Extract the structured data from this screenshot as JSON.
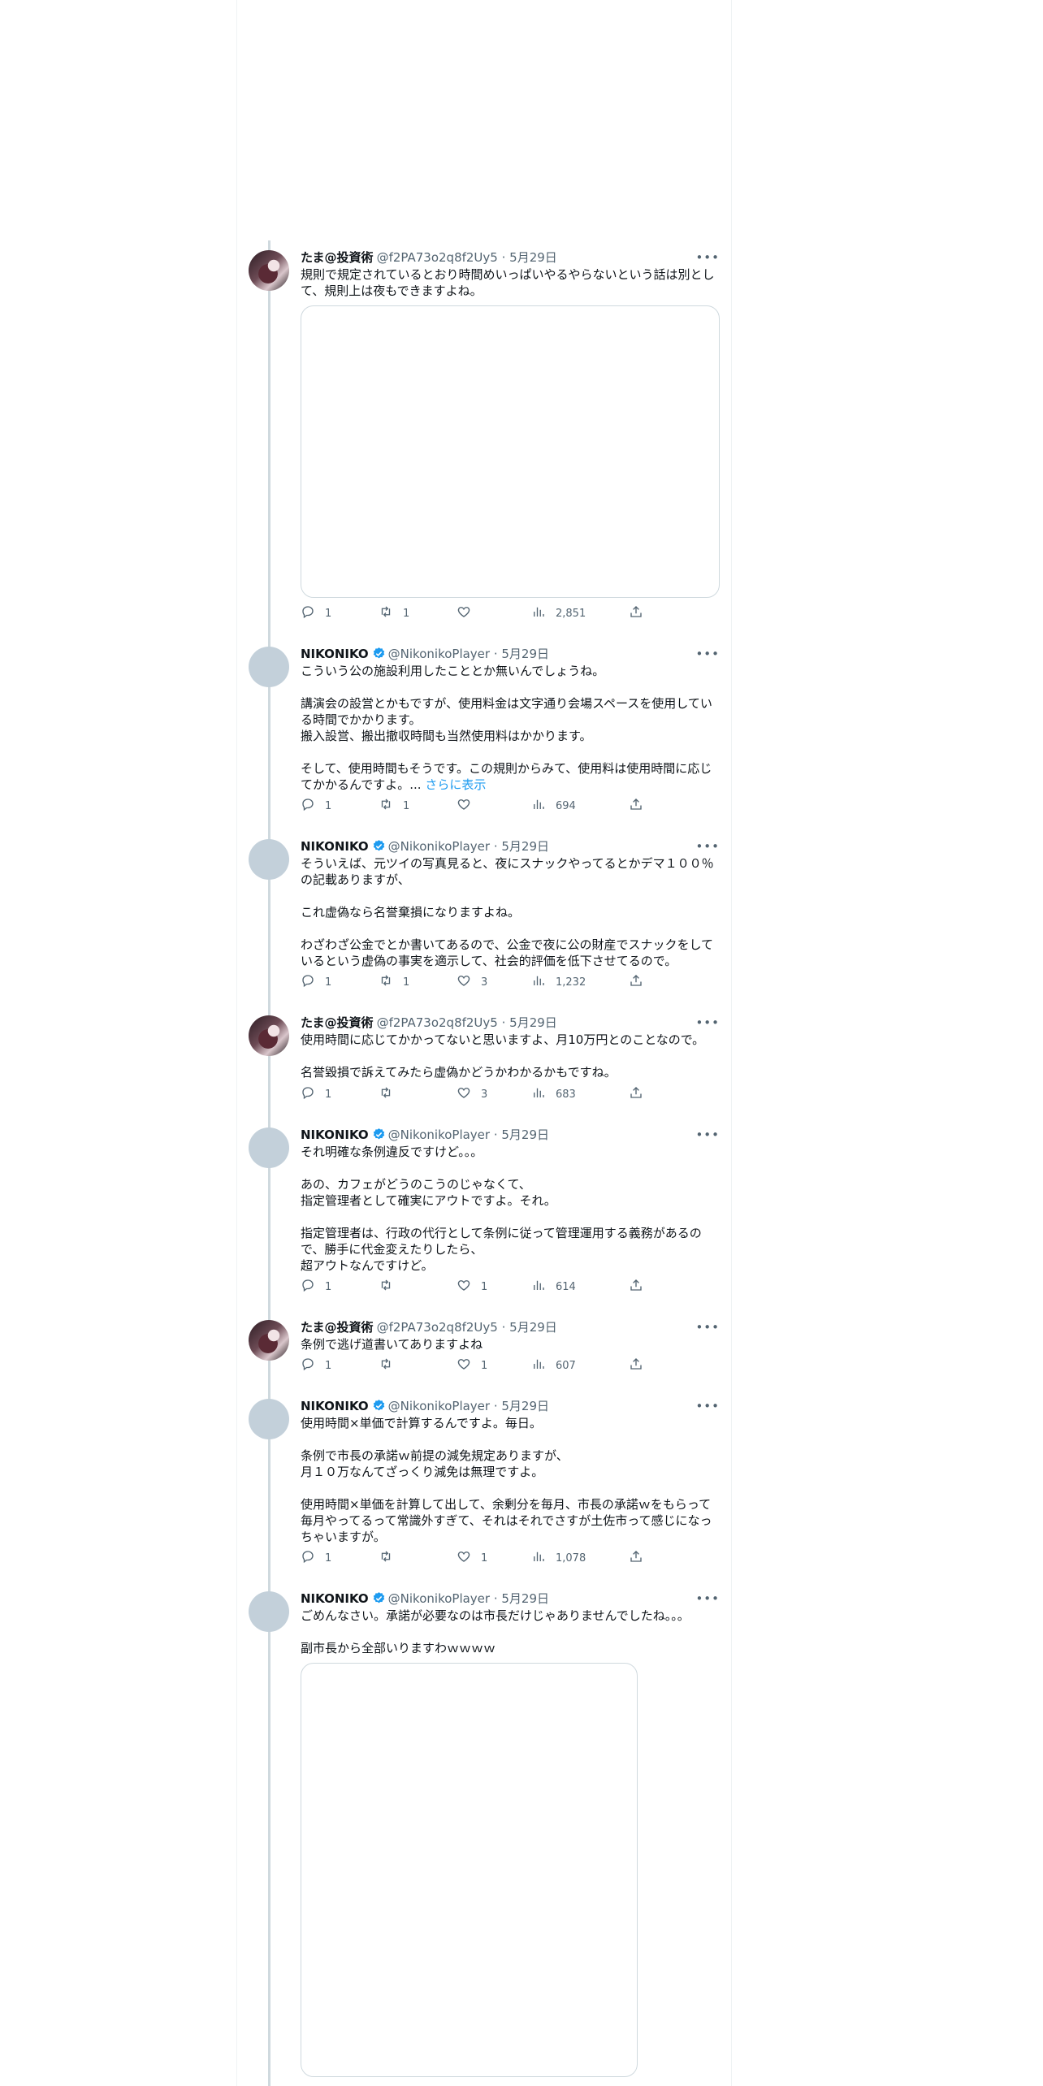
{
  "tweets": [
    {
      "name": "たま@投資術",
      "verified": false,
      "handle": "@f2PA73o2q8f2Uy5",
      "time": "5月29日",
      "text": "規則で規定されているとおり時間めいっぱいやるやらないという話は別として、規則上は夜もできますよね。",
      "show_more": "",
      "has_media": true,
      "replies": "1",
      "retweets": "1",
      "likes": "",
      "views": "2,851"
    },
    {
      "name": "NIKONIKO",
      "verified": true,
      "handle": "@NikonikoPlayer",
      "time": "5月29日",
      "text": "こういう公の施設利用したこととか無いんでしょうね。\n\n講演会の設営とかもですが、使用料金は文字通り会場スペースを使用している時間でかかります。\n搬入設営、搬出撤収時間も当然使用料はかかります。\n\nそして、使用時間もそうです。この規則からみて、使用料は使用時間に応じてかかるんですよ。... ",
      "show_more": "さらに表示",
      "has_media": false,
      "replies": "1",
      "retweets": "1",
      "likes": "",
      "views": "694"
    },
    {
      "name": "NIKONIKO",
      "verified": true,
      "handle": "@NikonikoPlayer",
      "time": "5月29日",
      "text": "そういえば、元ツイの写真見ると、夜にスナックやってるとかデマ１００％の記載ありますが、\n\nこれ虚偽なら名誉棄損になりますよね。\n\nわざわざ公金でとか書いてあるので、公金で夜に公の財産でスナックをしているという虚偽の事実を適示して、社会的評価を低下させてるので。",
      "show_more": "",
      "has_media": false,
      "replies": "1",
      "retweets": "1",
      "likes": "3",
      "views": "1,232"
    },
    {
      "name": "たま@投資術",
      "verified": false,
      "handle": "@f2PA73o2q8f2Uy5",
      "time": "5月29日",
      "text": "使用時間に応じてかかってないと思いますよ、月10万円とのことなので。\n\n名誉毀損で訴えてみたら虚偽かどうかわかるかもですね。",
      "show_more": "",
      "has_media": false,
      "replies": "1",
      "retweets": "",
      "likes": "3",
      "views": "683"
    },
    {
      "name": "NIKONIKO",
      "verified": true,
      "handle": "@NikonikoPlayer",
      "time": "5月29日",
      "text": "それ明確な条例違反ですけど。。。\n\nあの、カフェがどうのこうのじゃなくて、\n指定管理者として確実にアウトですよ。それ。\n\n指定管理者は、行政の代行として条例に従って管理運用する義務があるので、勝手に代金変えたりしたら、\n超アウトなんですけど。",
      "show_more": "",
      "has_media": false,
      "replies": "1",
      "retweets": "",
      "likes": "1",
      "views": "614"
    },
    {
      "name": "たま@投資術",
      "verified": false,
      "handle": "@f2PA73o2q8f2Uy5",
      "time": "5月29日",
      "text": "条例で逃げ道書いてありますよね",
      "show_more": "",
      "has_media": false,
      "replies": "1",
      "retweets": "",
      "likes": "1",
      "views": "607"
    },
    {
      "name": "NIKONIKO",
      "verified": true,
      "handle": "@NikonikoPlayer",
      "time": "5月29日",
      "text": "使用時間×単価で計算するんですよ。毎日。\n\n条例で市長の承諾ｗ前提の減免規定ありますが、\n月１０万なんてざっくり減免は無理ですよ。\n\n使用時間×単価を計算して出して、余剰分を毎月、市長の承諾ｗをもらって毎月やってるって常識外すぎて、それはそれでさすが土佐市って感じになっちゃいますが。",
      "show_more": "",
      "has_media": false,
      "replies": "1",
      "retweets": "",
      "likes": "1",
      "views": "1,078"
    },
    {
      "name": "NIKONIKO",
      "verified": true,
      "handle": "@NikonikoPlayer",
      "time": "5月29日",
      "text": "ごめんなさい。承諾が必要なのは市長だけじゃありませんでしたね。。。\n\n副市長から全部いりますわｗｗｗｗ",
      "show_more": "",
      "has_media": true,
      "replies": "",
      "retweets": "",
      "likes": "",
      "views": ""
    }
  ],
  "icons": {
    "more": "more-horizontal-icon",
    "reply": "reply-icon",
    "retweet": "retweet-icon",
    "like": "heart-icon",
    "views": "views-chart-icon",
    "share": "share-icon",
    "verified": "verified-badge-icon"
  },
  "colors": {
    "text": "#0f1419",
    "secondary": "#536471",
    "link": "#1d9bf0",
    "verified": "#1d9bf0",
    "thread_line": "#cfd9de"
  }
}
